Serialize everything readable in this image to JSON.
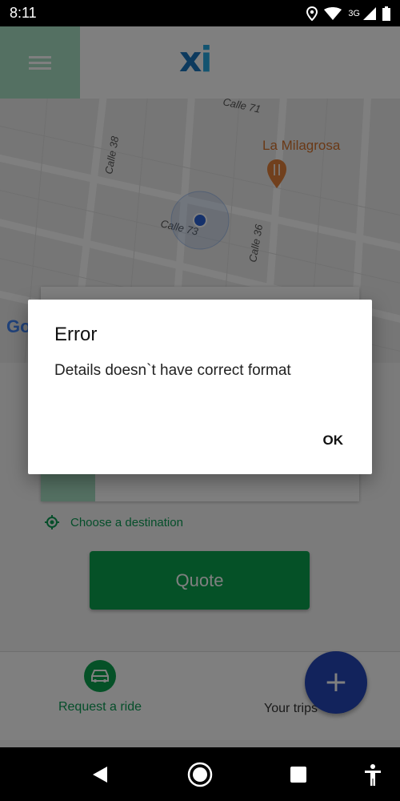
{
  "status_bar": {
    "time": "8:11",
    "network": "3G"
  },
  "app": {
    "logo": {
      "x": "x",
      "i": "i"
    },
    "map": {
      "street_labels": [
        "Calle 71",
        "Calle 38",
        "Calle 73",
        "Calle 36"
      ],
      "place_label": "La Milagrosa",
      "google_label": "Go"
    },
    "destination_label": "Choose a destination",
    "quote_button": "Quote",
    "bottom_nav": {
      "request_ride": "Request a ride",
      "your_trips": "Your trips"
    },
    "fab_label": "+"
  },
  "dialog": {
    "title": "Error",
    "message": "Details doesn`t have correct format",
    "ok_button": "OK"
  },
  "colors": {
    "brand_green": "#0aa24f",
    "brand_blue": "#1b75bc",
    "fab_blue": "#2446b8",
    "place_orange": "#d4722c"
  },
  "icons": [
    "location-icon",
    "wifi-icon",
    "cellular-icon",
    "battery-icon",
    "menu-icon",
    "restaurant-pin-icon",
    "my-location-dot-icon",
    "target-icon",
    "car-icon",
    "plus-icon",
    "back-icon",
    "home-icon",
    "recents-icon",
    "accessibility-icon"
  ]
}
